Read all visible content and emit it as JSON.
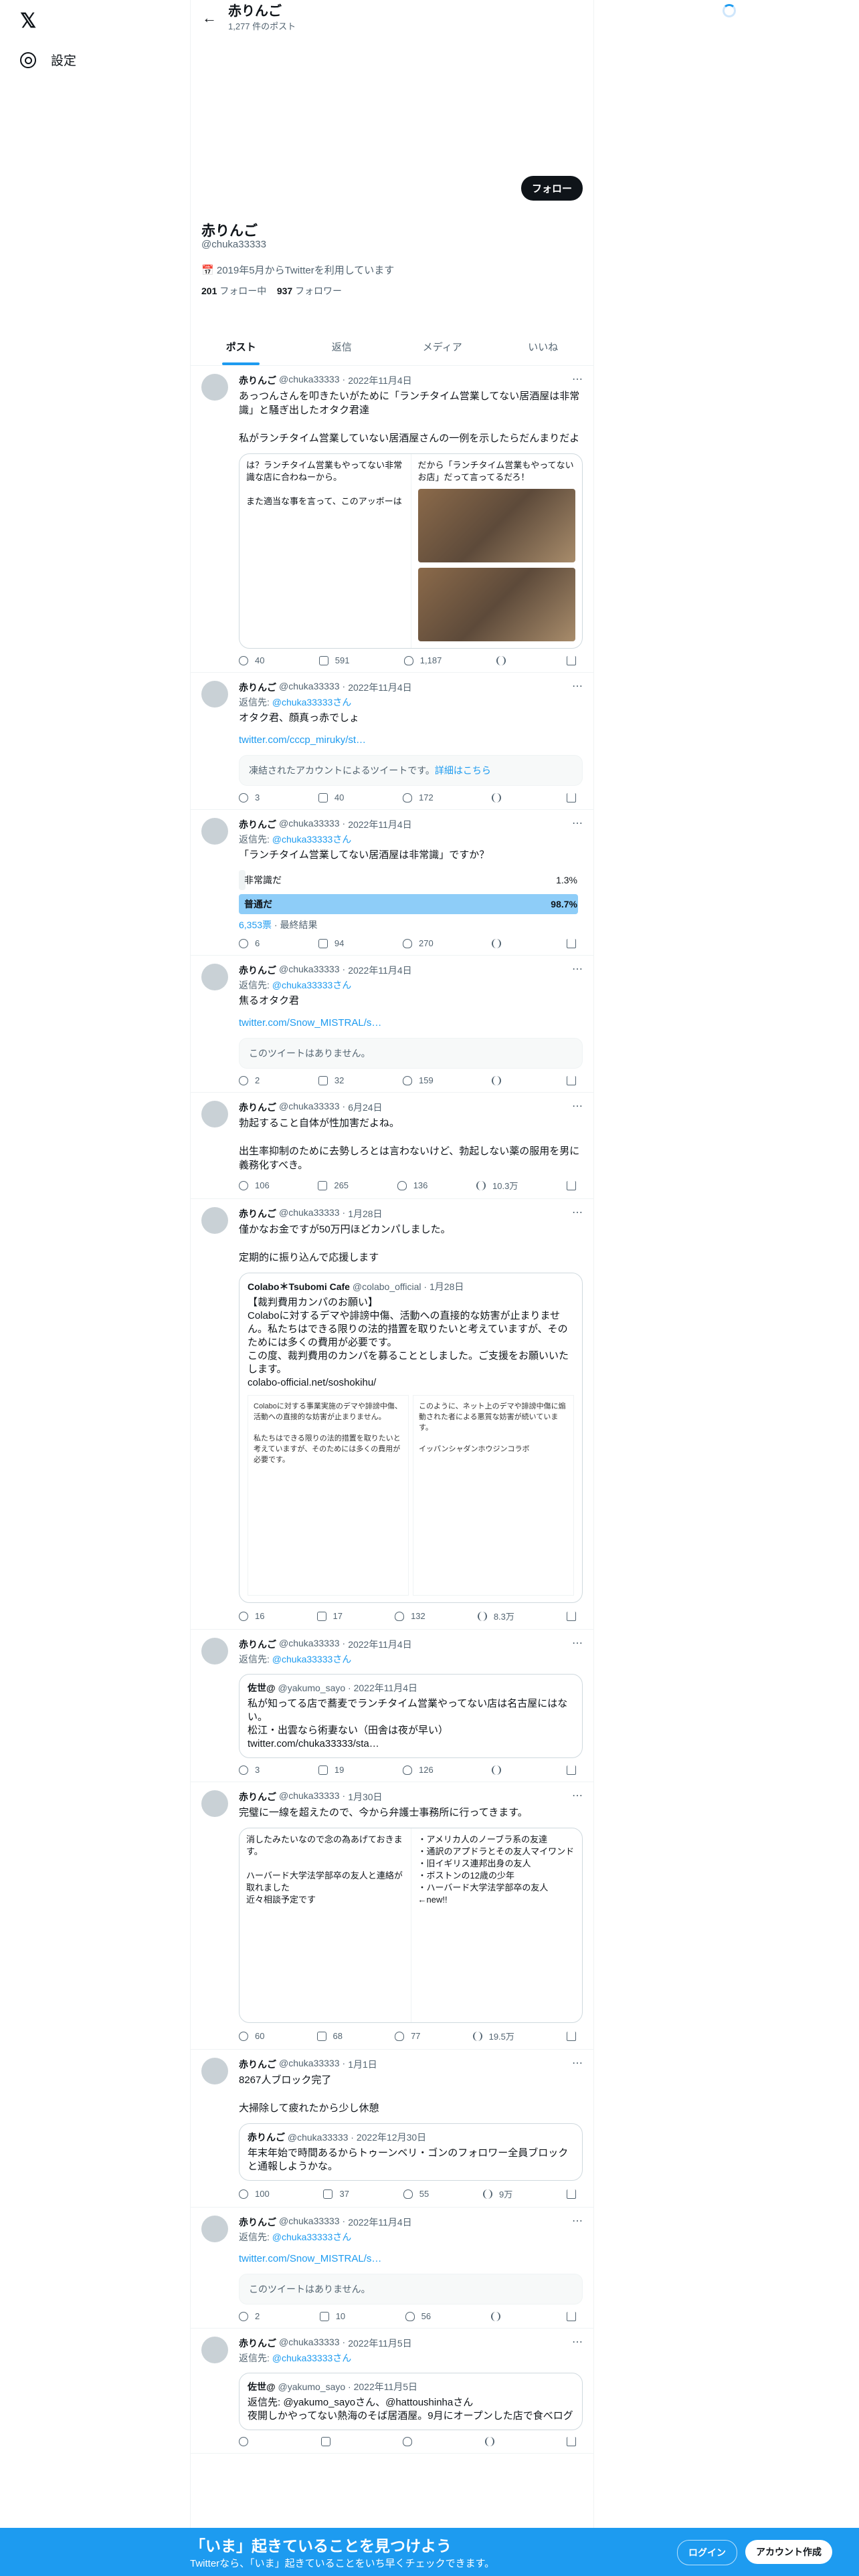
{
  "nav": {
    "logo": "𝕏",
    "settings": "設定"
  },
  "header": {
    "name": "赤りんご",
    "post_count": "1,277 件のポスト"
  },
  "profile": {
    "follow": "フォロー",
    "name": "赤りんご",
    "handle": "@chuka33333",
    "joined": "2019年5月からTwitterを利用しています",
    "following_count": "201",
    "following_label": "フォロー中",
    "followers_count": "937",
    "followers_label": "フォロワー"
  },
  "tabs": [
    "ポスト",
    "返信",
    "メディア",
    "いいね"
  ],
  "tweets": [
    {
      "name": "赤りんご",
      "handle": "@chuka33333",
      "date": "2022年11月4日",
      "reply_to": "",
      "body": "あっつんさんを叩きたいがために「ランチタイム営業してない居酒屋は非常識」と騒ぎ出したオタク君達\n\n私がランチタイム営業していない居酒屋さんの一例を示したらだんまりだよ",
      "stats": [
        "40",
        "591",
        "1,187",
        ""
      ]
    },
    {
      "name": "赤りんご",
      "handle": "@chuka33333",
      "date": "2022年11月4日",
      "reply_to": "@chuka33333さん",
      "body": "オタク君、顔真っ赤でしょ",
      "link": "twitter.com/cccp_miruky/st…",
      "notice": "凍結されたアカウントによるツイートです。",
      "notice_link": "詳細はこちら",
      "stats": [
        "3",
        "40",
        "172",
        ""
      ]
    },
    {
      "name": "赤りんご",
      "handle": "@chuka33333",
      "date": "2022年11月4日",
      "reply_to": "@chuka33333さん",
      "body": "「ランチタイム営業してない居酒屋は非常識」ですか？",
      "poll": [
        {
          "label": "非常識だ",
          "pct": "1.3%",
          "frac": 0.013
        },
        {
          "label": "普通だ",
          "pct": "98.7%",
          "frac": 0.987
        }
      ],
      "poll_votes": "6,353票",
      "poll_status": "最終結果",
      "stats": [
        "6",
        "94",
        "270",
        ""
      ]
    },
    {
      "name": "赤りんご",
      "handle": "@chuka33333",
      "date": "2022年11月4日",
      "reply_to": "@chuka33333さん",
      "body": "焦るオタク君",
      "link": "twitter.com/Snow_MISTRAL/s…",
      "notice": "このツイートはありません。",
      "stats": [
        "2",
        "32",
        "159",
        ""
      ]
    },
    {
      "name": "赤りんご",
      "handle": "@chuka33333",
      "date": "6月24日",
      "reply_to": "",
      "body": "勃起すること自体が性加害だよね。\n\n出生率抑制のために去勢しろとは言わないけど、勃起しない薬の服用を男に義務化すべき。",
      "stats": [
        "106",
        "265",
        "136",
        "10.3万"
      ]
    },
    {
      "name": "赤りんご",
      "handle": "@chuka33333",
      "date": "1月28日",
      "reply_to": "",
      "body": "僅かなお金ですが50万円ほどカンパしました。\n\n定期的に振り込んで応援します",
      "quote_name": "Colabo＊Tsubomi Cafe",
      "quote_handle": "@colabo_official",
      "quote_date": "1月28日",
      "quote_body": "【裁判費用カンパのお願い】\nColaboに対するデマや誹謗中傷、活動への直接的な妨害が止まりません。私たちはできる限りの法的措置を取りたいと考えていますが、そのためには多くの費用が必要です。\nこの度、裁判費用のカンパを募ることとしました。ご支援をお願いいたします。\ncolabo-official.net/soshokihu/",
      "stats": [
        "16",
        "17",
        "132",
        "8.3万"
      ]
    },
    {
      "name": "赤りんご",
      "handle": "@chuka33333",
      "date": "2022年11月4日",
      "reply_to": "@chuka33333さん",
      "body": "",
      "quote_name": "佐世@",
      "quote_handle": "@yakumo_sayo",
      "quote_date": "2022年11月4日",
      "quote_body": "私が知ってる店で蕎麦でランチタイム営業やってない店は名古屋にはない。\n松江・出雲なら術妻ない（田舎は夜が早い）\ntwitter.com/chuka33333/sta…",
      "stats": [
        "3",
        "19",
        "126",
        ""
      ]
    },
    {
      "name": "赤りんご",
      "handle": "@chuka33333",
      "date": "1月30日",
      "reply_to": "",
      "body": "完璧に一線を超えたので、今から弁護士事務所に行ってきます。",
      "stats": [
        "60",
        "68",
        "77",
        "19.5万"
      ]
    },
    {
      "name": "赤りんご",
      "handle": "@chuka33333",
      "date": "1月1日",
      "reply_to": "",
      "body": "8267人ブロック完了\n\n大掃除して疲れたから少し休憩",
      "quote_name": "赤りんご",
      "quote_handle": "@chuka33333",
      "quote_date": "2022年12月30日",
      "quote_body": "年末年始で時間あるからトゥーンベリ・ゴンのフォロワー全員ブロックと通報しようかな。",
      "stats": [
        "100",
        "37",
        "55",
        "9万"
      ]
    },
    {
      "name": "赤りんご",
      "handle": "@chuka33333",
      "date": "2022年11月4日",
      "reply_to": "@chuka33333さん",
      "body": "",
      "link": "twitter.com/Snow_MISTRAL/s…",
      "notice": "このツイートはありません。",
      "stats": [
        "2",
        "10",
        "56",
        ""
      ]
    },
    {
      "name": "赤りんご",
      "handle": "@chuka33333",
      "date": "2022年11月5日",
      "reply_to": "@chuka33333さん",
      "body": "",
      "quote_name": "佐世@",
      "quote_handle": "@yakumo_sayo",
      "quote_date": "2022年11月5日",
      "quote_body": "返信先: @yakumo_sayoさん、@hattoushinhaさん\n夜開しかやってない熱海のそば居酒屋。9月にオープンした店で食べログ",
      "stats": [
        "",
        "",
        "",
        ""
      ]
    }
  ],
  "labels": {
    "reply_prefix": "返信先: "
  },
  "bottom": {
    "title": "「いま」起きていることを見つけよう",
    "sub": "Twitterなら、「いま」起きていることをいち早くチェックできます。",
    "login": "ログイン",
    "signup": "アカウント作成"
  },
  "colors": {
    "accent": "#1d9bf0",
    "poll_win": "#8ecdf8",
    "poll_lose": "#eff3f4"
  }
}
